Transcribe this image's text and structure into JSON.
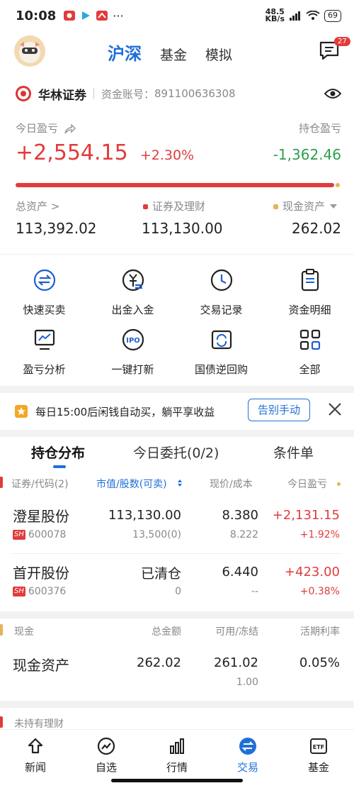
{
  "status_bar": {
    "time": "10:08",
    "net_speed": "48.5",
    "net_unit": "KB/s",
    "battery": "69"
  },
  "top_nav": {
    "tabs": [
      "沪深",
      "基金",
      "模拟"
    ],
    "active_tab": "沪深",
    "message_badge": "27"
  },
  "account": {
    "broker": "华林证券",
    "label": "资金账号：",
    "number": "891100636308"
  },
  "pnl": {
    "today_label": "今日盈亏",
    "today_value": "+2,554.15",
    "today_pct": "+2.30%",
    "hold_label": "持仓盈亏",
    "hold_value": "-1,362.46"
  },
  "assets": {
    "total_label": "总资产 >",
    "total_value": "113,392.02",
    "securities_label": "证券及理财",
    "securities_value": "113,130.00",
    "cash_label": "现金资产",
    "cash_value": "262.02"
  },
  "grid": {
    "row1": [
      {
        "label": "快速买卖",
        "icon": "swap-icon"
      },
      {
        "label": "出金入金",
        "icon": "yuan-transfer-icon"
      },
      {
        "label": "交易记录",
        "icon": "clock-icon"
      },
      {
        "label": "资金明细",
        "icon": "clipboard-icon"
      }
    ],
    "row2": [
      {
        "label": "盈亏分析",
        "icon": "chart-monitor-icon"
      },
      {
        "label": "一键打新",
        "icon": "ipo-icon"
      },
      {
        "label": "国债逆回购",
        "icon": "bond-repo-icon"
      },
      {
        "label": "全部",
        "icon": "grid-icon"
      }
    ]
  },
  "promo": {
    "text": "每日15:00后闲钱自动买，躺平享收益",
    "button": "告别手动"
  },
  "holdings_tabs": {
    "tab1": "持仓分布",
    "tab2": "今日委托(0/2)",
    "tab3": "条件单"
  },
  "holdings_header": {
    "col1": "证券/代码(2)",
    "col2": "市值/股数(可卖)",
    "col3": "现价/成本",
    "col4": "今日盈亏"
  },
  "holdings": [
    {
      "name": "澄星股份",
      "market": "SH",
      "code": "600078",
      "market_value": "113,130.00",
      "shares": "13,500(0)",
      "price": "8.380",
      "cost": "8.222",
      "pnl": "+2,131.15",
      "pnl_pct": "+1.92%"
    },
    {
      "name": "首开股份",
      "market": "SH",
      "code": "600376",
      "market_value": "已清仓",
      "shares": "0",
      "price": "6.440",
      "cost": "--",
      "pnl": "+423.00",
      "pnl_pct": "+0.38%"
    }
  ],
  "cash_header": {
    "col1": "现金",
    "col2": "总金额",
    "col3": "可用/冻结",
    "col4": "活期利率"
  },
  "cash_row": {
    "name": "现金资产",
    "total": "262.02",
    "available": "261.02",
    "frozen": "1.00",
    "rate": "0.05%"
  },
  "wealth_header": "未持有理财",
  "bottom_nav": {
    "items": [
      {
        "label": "新闻",
        "icon": "news-icon"
      },
      {
        "label": "自选",
        "icon": "trend-icon"
      },
      {
        "label": "行情",
        "icon": "bars-icon"
      },
      {
        "label": "交易",
        "icon": "trade-icon"
      },
      {
        "label": "基金",
        "icon": "etf-icon"
      }
    ],
    "active": "交易"
  },
  "colors": {
    "accent": "#1f6fd8",
    "up": "#e23b3b",
    "down": "#2e9e4f",
    "cash_dot": "#e6b25a"
  }
}
